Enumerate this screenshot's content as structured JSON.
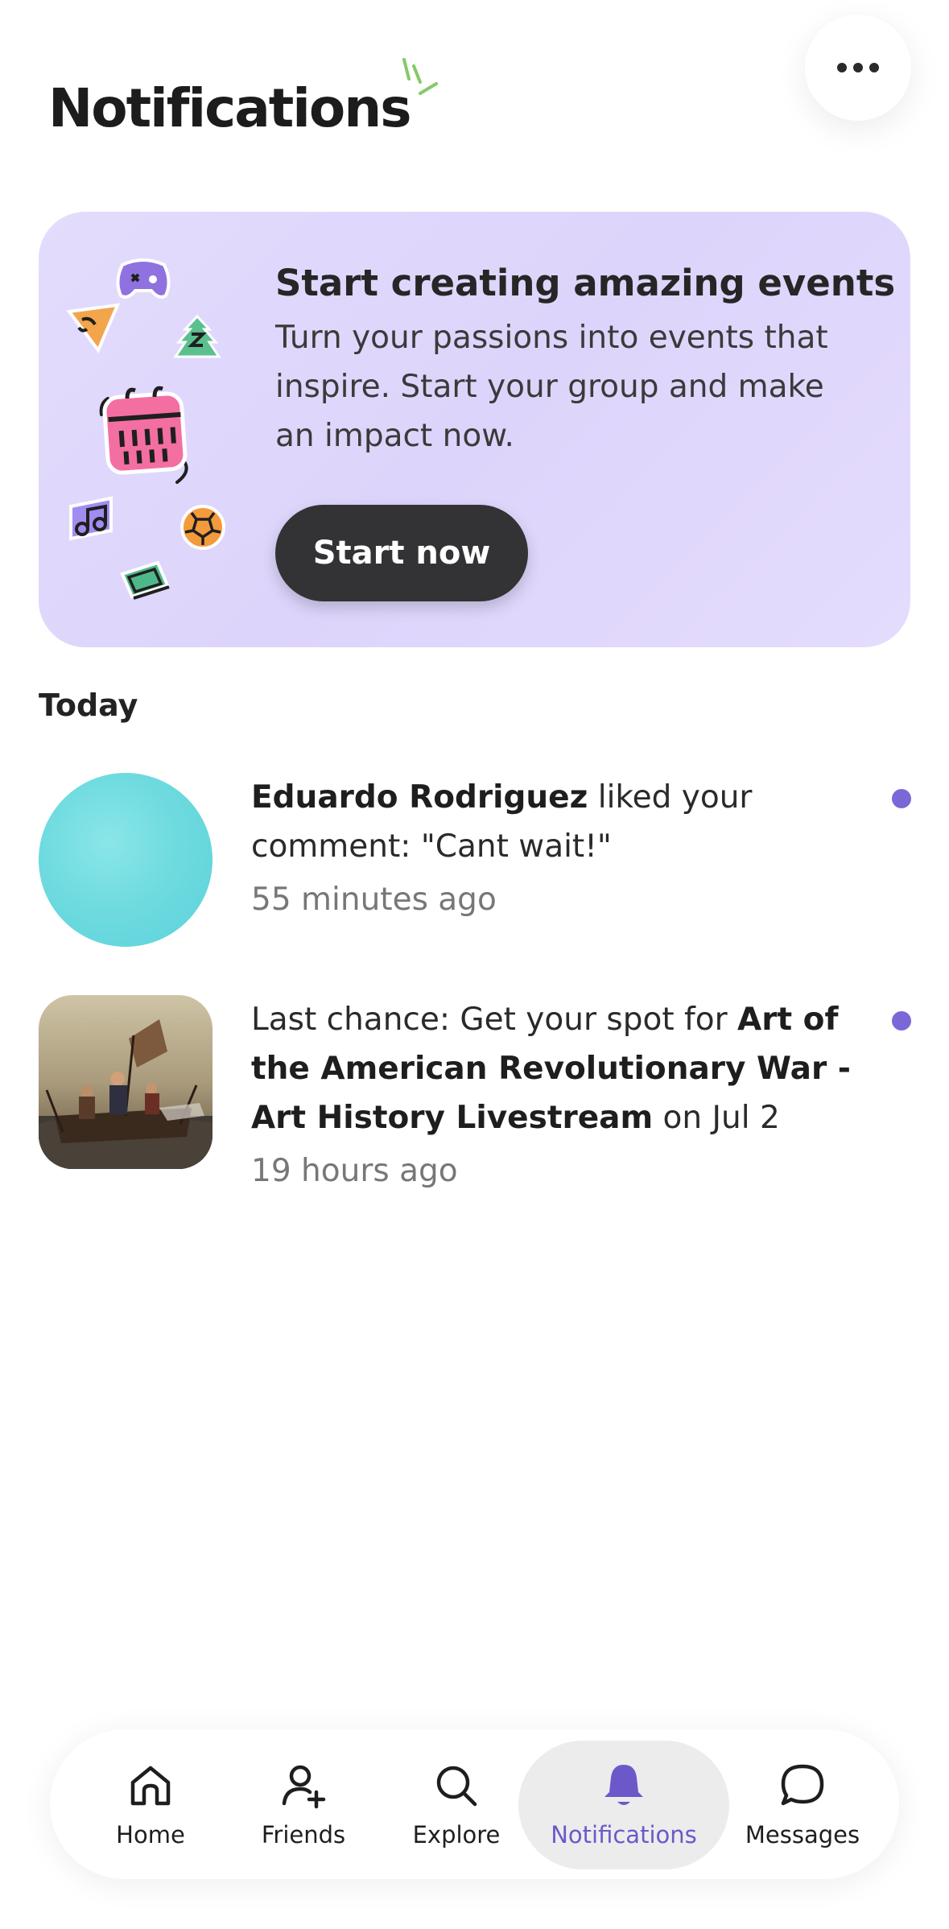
{
  "header": {
    "title": "Notifications",
    "more_icon": "more-horizontal-icon"
  },
  "promo": {
    "title": "Start creating amazing events",
    "text": "Turn your passions into events that inspire. Start your group and make an impact now.",
    "button_label": "Start now",
    "background_color": "#e0d8fc",
    "stickers": [
      "game-controller-icon",
      "pizza-icon",
      "tree-icon",
      "calendar-icon",
      "music-note-icon",
      "soccer-ball-icon",
      "laptop-icon"
    ]
  },
  "section": {
    "label": "Today"
  },
  "notifications": [
    {
      "actor": "Eduardo Rodriguez",
      "text": " liked your comment: \"Cant wait!\"",
      "time": "55 minutes ago",
      "unread": true
    },
    {
      "prefix": "Last chance: Get your spot for ",
      "event": "Art of the American Revolutionary War - Art History Livestream",
      "suffix": " on Jul 2",
      "time": "19 hours ago",
      "unread": true
    }
  ],
  "tabbar": {
    "accent_color": "#6c58c9",
    "items": [
      {
        "label": "Home",
        "icon": "home-icon"
      },
      {
        "label": "Friends",
        "icon": "add-friend-icon"
      },
      {
        "label": "Explore",
        "icon": "search-icon"
      },
      {
        "label": "Notifications",
        "icon": "bell-icon",
        "active": true
      },
      {
        "label": "Messages",
        "icon": "chat-bubble-icon"
      }
    ]
  }
}
